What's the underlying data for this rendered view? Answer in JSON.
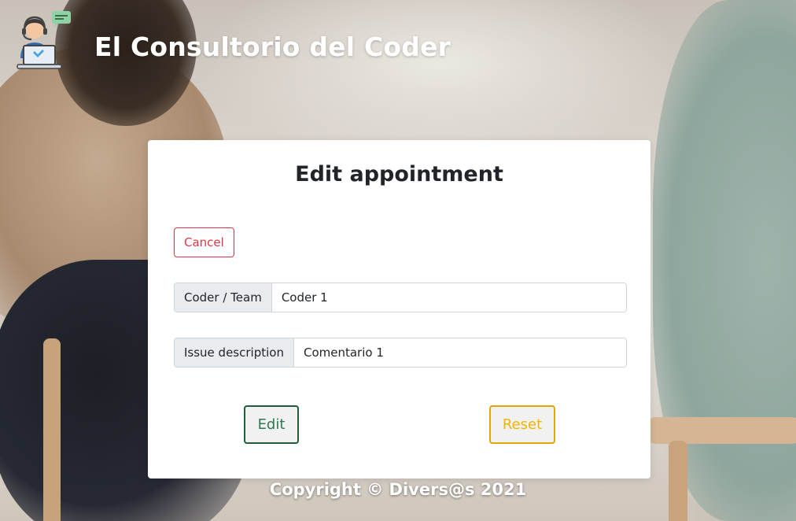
{
  "header": {
    "brand_title": "El Consultorio del Coder",
    "logo_icon": "support-agent-laptop-icon"
  },
  "card": {
    "title": "Edit appointment",
    "cancel_label": "Cancel",
    "fields": {
      "coder": {
        "label": "Coder / Team",
        "value": "Coder 1"
      },
      "issue": {
        "label": "Issue description",
        "value": "Comentario 1"
      }
    },
    "edit_label": "Edit",
    "reset_label": "Reset"
  },
  "footer": {
    "copyright": "Copyright © Divers@s 2021"
  },
  "colors": {
    "danger": "#dc3545",
    "success": "#1e5c3a",
    "warning": "#e0a800"
  }
}
